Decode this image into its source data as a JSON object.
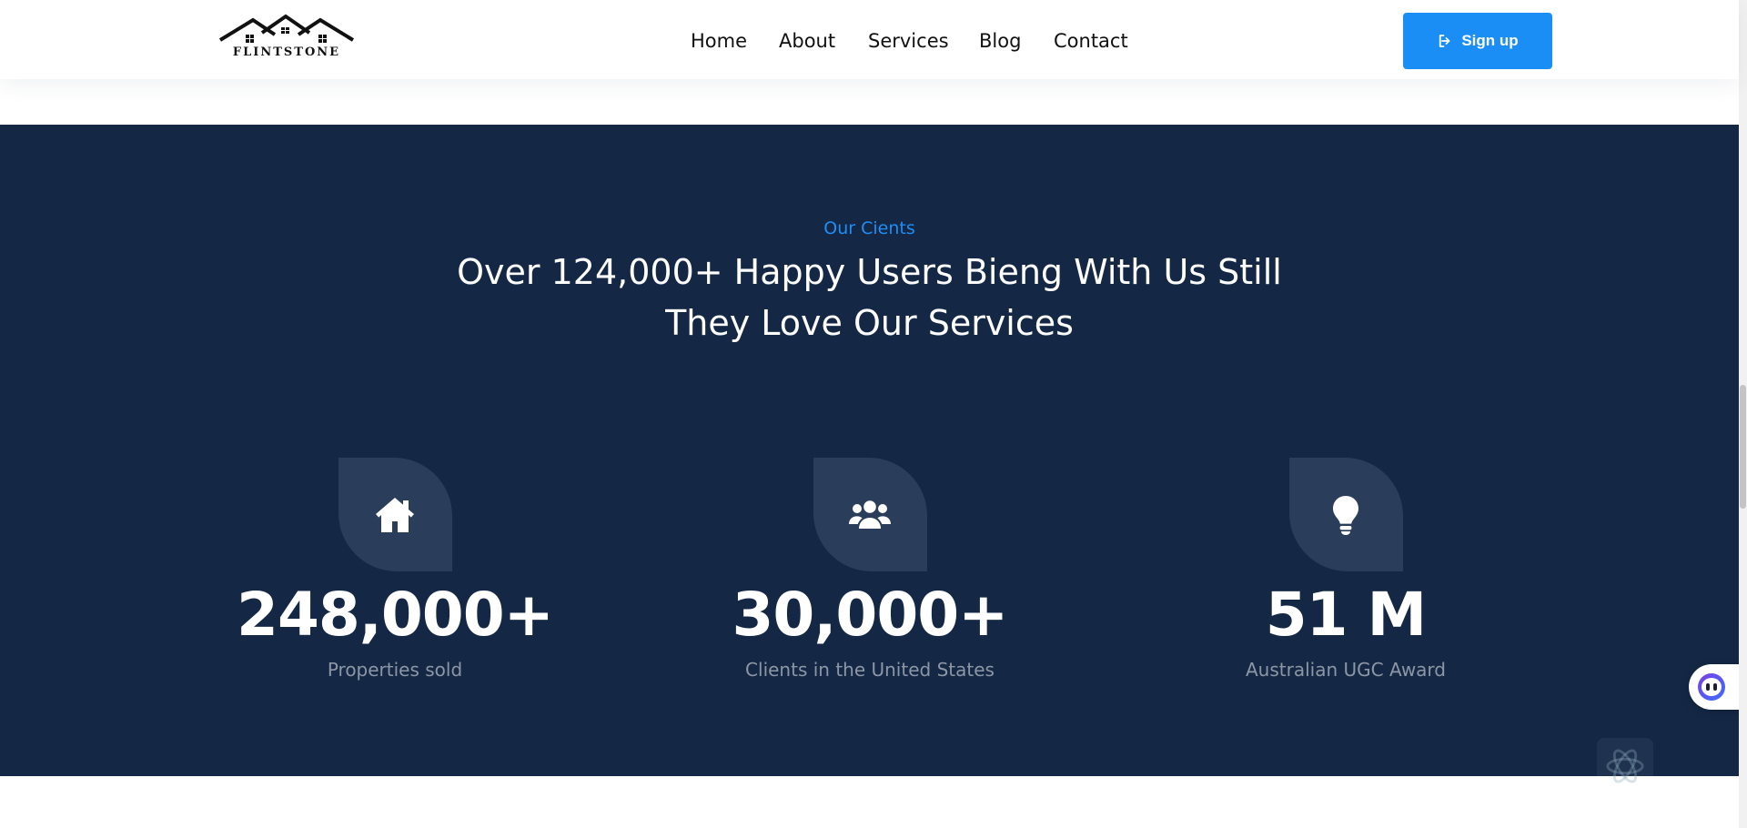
{
  "header": {
    "logo_text": "FLINTSTONE",
    "nav": [
      {
        "label": "Home"
      },
      {
        "label": "About"
      },
      {
        "label": "Services"
      },
      {
        "label": "Blog"
      },
      {
        "label": "Contact"
      }
    ],
    "signup_label": "Sign up",
    "signup_icon": "sign-in-icon"
  },
  "clients": {
    "eyebrow": "Our Cients",
    "headline_line1": "Over 124,000+ Happy Users Bieng With Us Still",
    "headline_line2": "They Love Our Services",
    "stats": [
      {
        "icon": "house-icon",
        "value": "248,000+",
        "label": "Properties sold"
      },
      {
        "icon": "users-icon",
        "value": "30,000+",
        "label": "Clients in the United States"
      },
      {
        "icon": "lightbulb-icon",
        "value": "51 M",
        "label": "Australian UGC Award"
      }
    ]
  },
  "colors": {
    "brand_blue": "#1b8ef5",
    "section_bg": "#142846",
    "icon_tile": "#2a3d5a",
    "label_gray": "#8d96a4"
  }
}
